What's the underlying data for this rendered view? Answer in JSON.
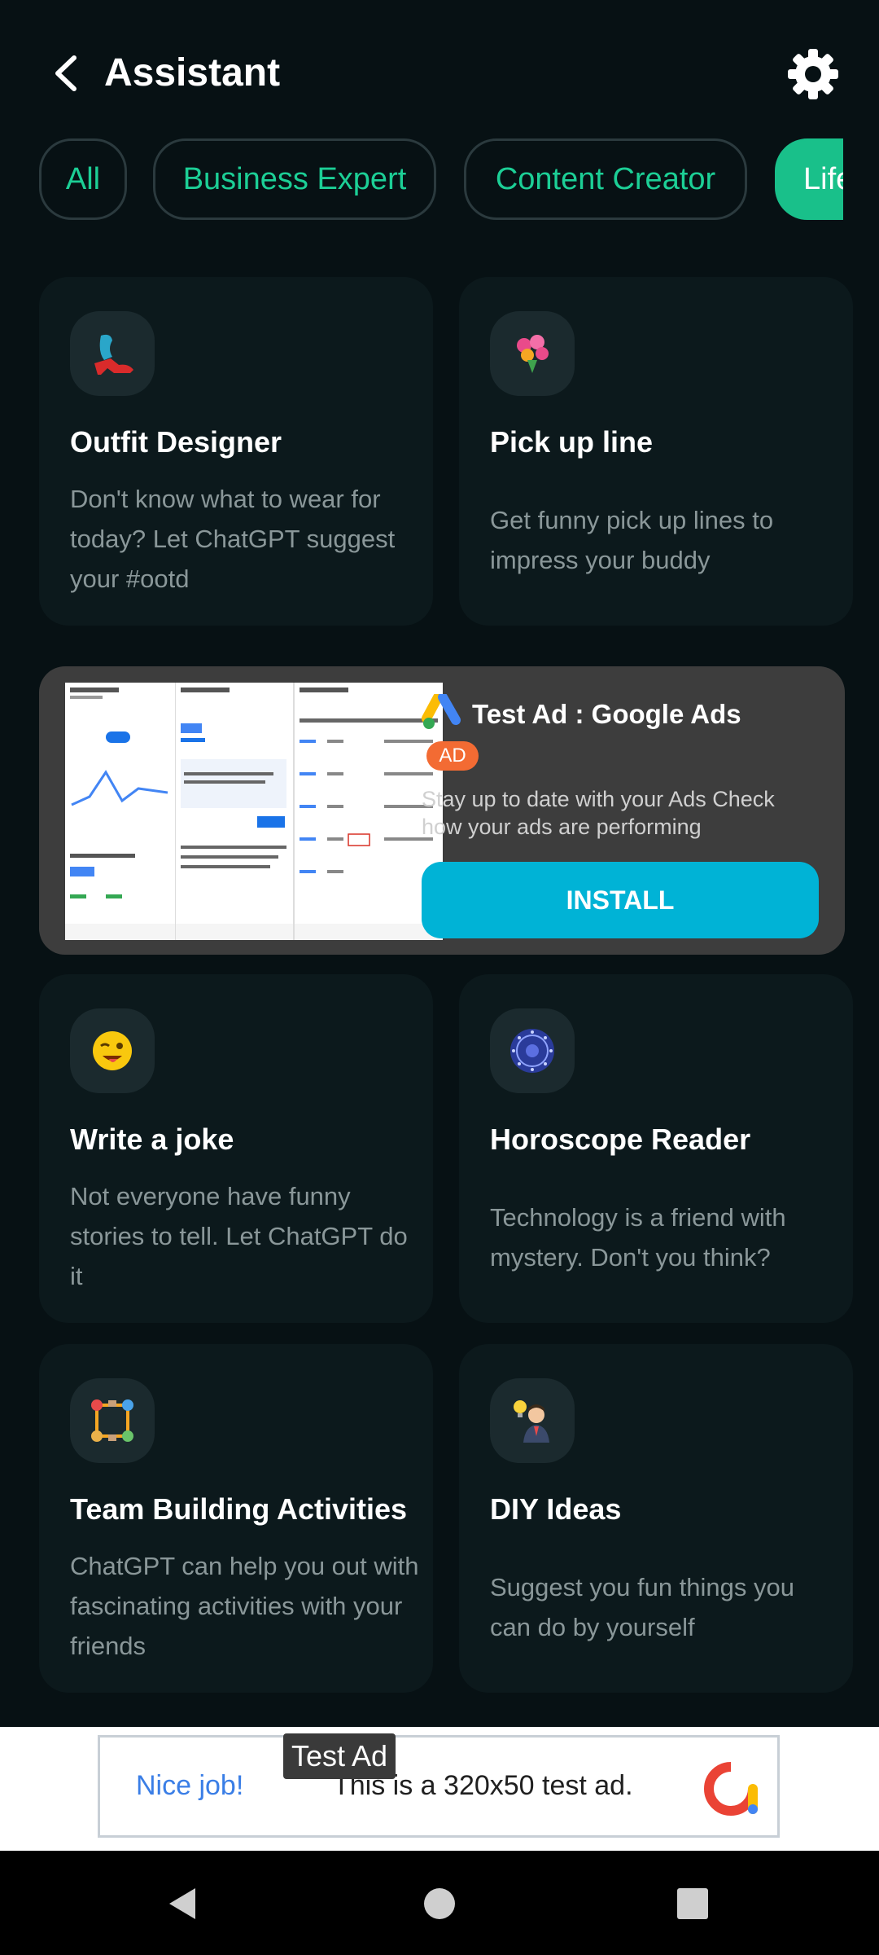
{
  "header": {
    "title": "Assistant"
  },
  "chips": [
    {
      "label": "All"
    },
    {
      "label": "Business Expert"
    },
    {
      "label": "Content Creator"
    },
    {
      "label": "Life"
    }
  ],
  "cards": [
    {
      "title": "Outfit Designer",
      "desc": "Don't know what to wear for today? Let ChatGPT suggest your #ootd",
      "icon": "high-heel-shoe-icon"
    },
    {
      "title": "Pick up line",
      "desc": "Get funny pick up lines to impress your buddy",
      "icon": "flower-bouquet-icon"
    },
    {
      "title": "Write a joke",
      "desc": "Not everyone have funny stories to tell. Let ChatGPT do it",
      "icon": "winking-face-icon"
    },
    {
      "title": "Horoscope Reader",
      "desc": "Technology is a friend with mystery. Don't you think?",
      "icon": "zodiac-wheel-icon"
    },
    {
      "title": "Team Building Activities",
      "desc": "ChatGPT can help you out with fascinating activities with your friends",
      "icon": "team-people-icon"
    },
    {
      "title": "DIY Ideas",
      "desc": "Suggest you fun things you can do by yourself",
      "icon": "person-lightbulb-icon"
    }
  ],
  "ad": {
    "title": "Test Ad : Google Ads",
    "badge": "AD",
    "desc": "Stay up to date with your Ads Check how your ads are performing",
    "install": "INSTALL"
  },
  "banner": {
    "label": "Test Ad",
    "nice": "Nice job!",
    "text": "This is a 320x50 test ad."
  },
  "colors": {
    "background": "#071114",
    "card": "#0c191c",
    "accent": "#19c08a",
    "install": "#00b3d6",
    "badge": "#f36b33"
  }
}
